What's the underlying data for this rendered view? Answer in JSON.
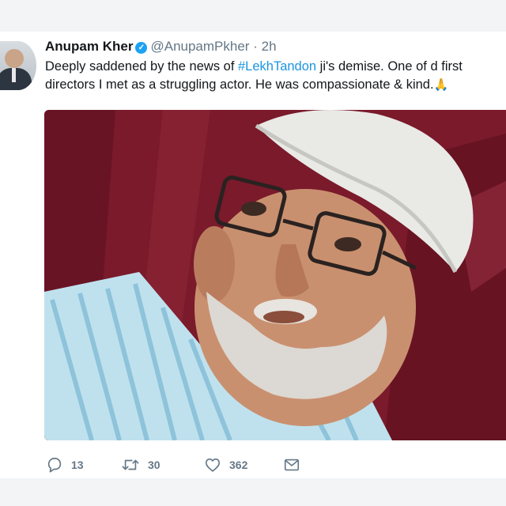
{
  "tweet": {
    "author_name": "Anupam Kher",
    "handle": "@AnupamPkher",
    "separator": "·",
    "time": "2h",
    "text_before": "Deeply saddened by the news of ",
    "hashtag": "#LekhTandon",
    "text_after": " ji's demise. One of d first directors I met as a struggling actor. He was compassionate & kind.",
    "emoji": "🙏"
  },
  "actions": {
    "replies": "13",
    "retweets": "30",
    "likes": "362"
  },
  "icons": {
    "verified": "verified-badge-icon",
    "reply": "reply-icon",
    "retweet": "retweet-icon",
    "like": "heart-icon",
    "message": "direct-message-icon"
  },
  "colors": {
    "accent": "#1da1f2",
    "link": "#1b95e0",
    "muted": "#657786"
  }
}
